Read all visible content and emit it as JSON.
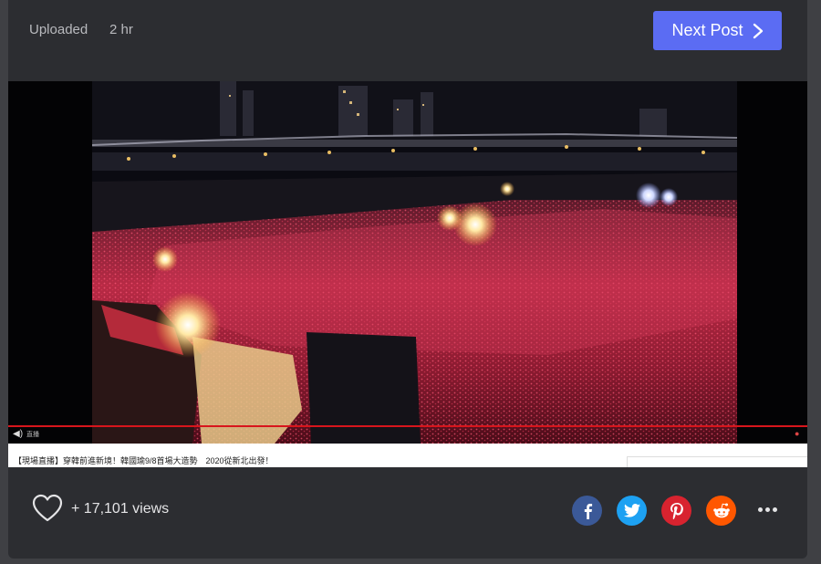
{
  "header": {
    "uploaded_label": "Uploaded",
    "time_ago": "2 hr",
    "next_post_label": "Next Post"
  },
  "video": {
    "caption": "【現場直播】穿韓前進新境！韓國瑜9/8首場大造勢　2020從新北出發！",
    "volume_label": "直播",
    "progress_color": "#d8151c"
  },
  "footer": {
    "likes_text": "+ 17,101 views",
    "share": {
      "facebook_color": "#3b5998",
      "twitter_color": "#1da1f2",
      "pinterest_color": "#d8232f",
      "reddit_color": "#ff5700"
    }
  },
  "colors": {
    "accent": "#5b6cf3",
    "background": "#2c2d31"
  }
}
